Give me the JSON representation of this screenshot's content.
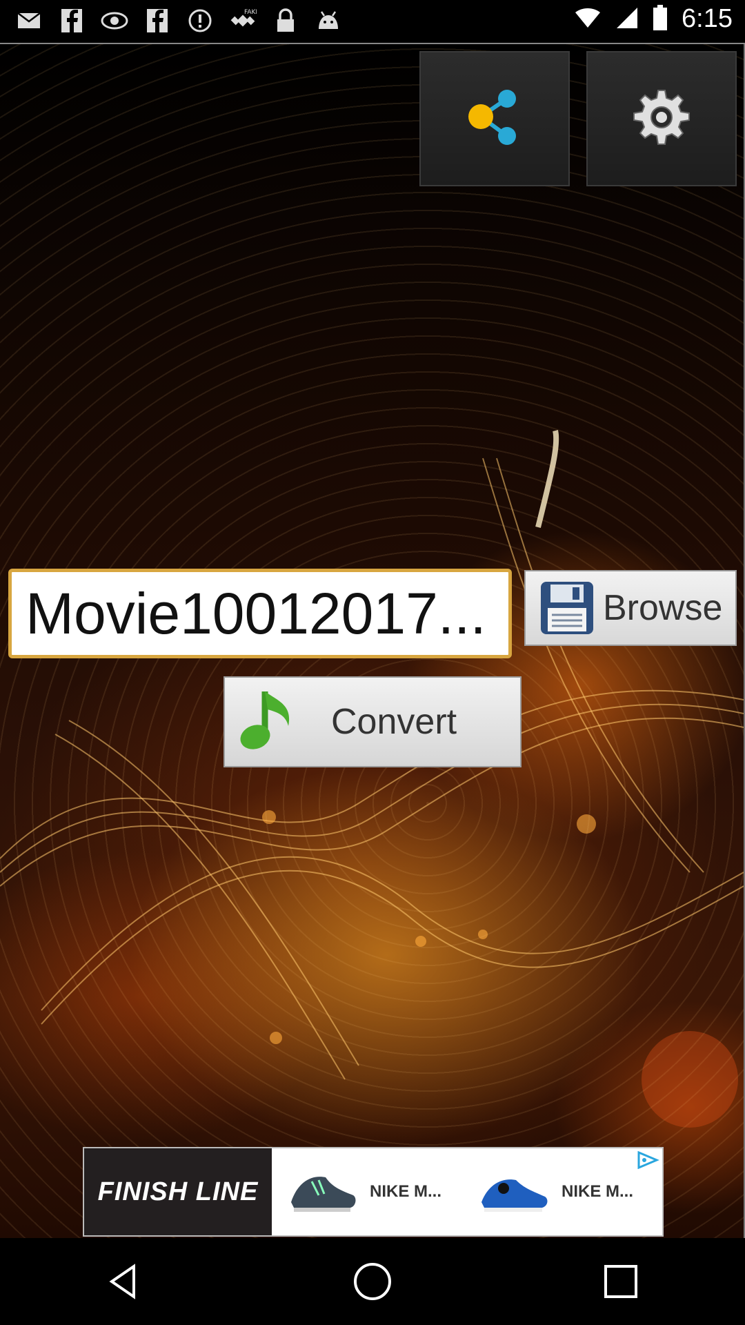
{
  "status_bar": {
    "time": "6:15",
    "icons": [
      "email-icon",
      "facebook-icon",
      "vision-icon",
      "facebook-icon",
      "info-icon",
      "fake-gps-icon",
      "lock-icon",
      "android-icon"
    ]
  },
  "toolbar": {
    "share_icon": "share-icon",
    "settings_icon": "gear-icon"
  },
  "file": {
    "name": "Movie10012017..."
  },
  "buttons": {
    "browse_label": "Browse",
    "convert_label": "Convert"
  },
  "ad": {
    "brand": "FINISH LINE",
    "items": [
      {
        "label": "NIKE M..."
      },
      {
        "label": "NIKE M..."
      }
    ]
  },
  "colors": {
    "share_yellow": "#f5b800",
    "share_cyan": "#29a9d6",
    "music_green": "#4caf2e",
    "filename_border": "#d8a640"
  }
}
